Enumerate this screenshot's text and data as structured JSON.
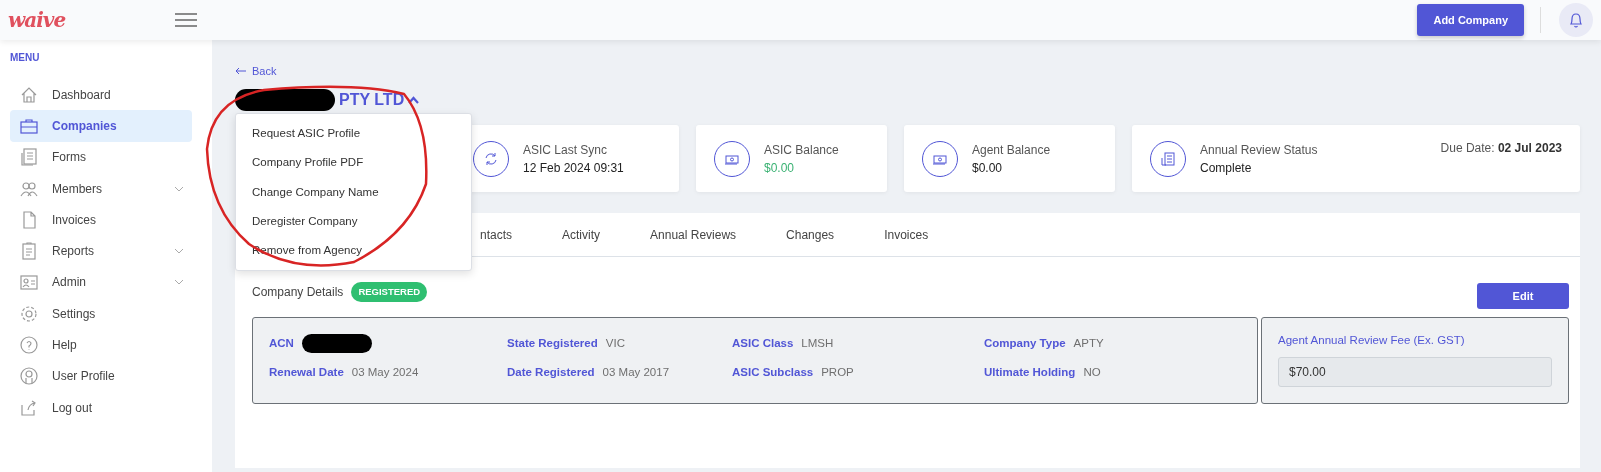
{
  "brand": "waive",
  "topbar": {
    "add_button": "Add Company"
  },
  "sidebar": {
    "heading": "MENU",
    "items": [
      {
        "label": "Dashboard",
        "selected": false,
        "expandable": false
      },
      {
        "label": "Companies",
        "selected": true,
        "expandable": false
      },
      {
        "label": "Forms",
        "selected": false,
        "expandable": false
      },
      {
        "label": "Members",
        "selected": false,
        "expandable": true
      },
      {
        "label": "Invoices",
        "selected": false,
        "expandable": false
      },
      {
        "label": "Reports",
        "selected": false,
        "expandable": true
      },
      {
        "label": "Admin",
        "selected": false,
        "expandable": true
      },
      {
        "label": "Settings",
        "selected": false,
        "expandable": false
      },
      {
        "label": "Help",
        "selected": false,
        "expandable": false
      },
      {
        "label": "User Profile",
        "selected": false,
        "expandable": false
      },
      {
        "label": "Log out",
        "selected": false,
        "expandable": false
      }
    ]
  },
  "back_link": "Back",
  "company": {
    "name": "PTY LTD",
    "redacted": true,
    "expanded": true
  },
  "dropdown": [
    "Request ASIC Profile",
    "Company Profile PDF",
    "Change Company Name",
    "Deregister Company",
    "Remove from Agency"
  ],
  "annotation_circle": true,
  "stats": [
    {
      "kind": "sync",
      "label": "ASIC Last Sync",
      "value": "12 Feb 2024 09:31",
      "positive": false
    },
    {
      "kind": "money",
      "label": "ASIC Balance",
      "value": "$0.00",
      "positive": true
    },
    {
      "kind": "money",
      "label": "Agent Balance",
      "value": "$0.00",
      "positive": false
    },
    {
      "kind": "doc",
      "label": "Annual Review Status",
      "value": "Complete",
      "positive": false,
      "due_label": "Due Date:",
      "due_value": "02 Jul 2023"
    }
  ],
  "tabs": [
    {
      "label": "ntacts",
      "selected": false
    },
    {
      "label": "Activity",
      "selected": false
    },
    {
      "label": "Annual Reviews",
      "selected": false
    },
    {
      "label": "Changes",
      "selected": false
    },
    {
      "label": "Invoices",
      "selected": false
    }
  ],
  "details": {
    "title": "Company Details",
    "status": "REGISTERED",
    "edit_button": "Edit",
    "fields": [
      {
        "label": "ACN",
        "redacted": true
      },
      {
        "label": "Renewal Date",
        "value": "03 May 2024"
      },
      {
        "label": "State Registered",
        "value": "VIC"
      },
      {
        "label": "Date Registered",
        "value": "03 May 2017"
      },
      {
        "label": "ASIC Class",
        "value": "LMSH"
      },
      {
        "label": "ASIC Subclass",
        "value": "PROP"
      },
      {
        "label": "Company Type",
        "value": "APTY"
      },
      {
        "label": "Ultimate Holding",
        "value": "NO"
      }
    ],
    "fee_label": "Agent Annual Review Fee (Ex. GST)",
    "fee_value": "$70.00"
  }
}
